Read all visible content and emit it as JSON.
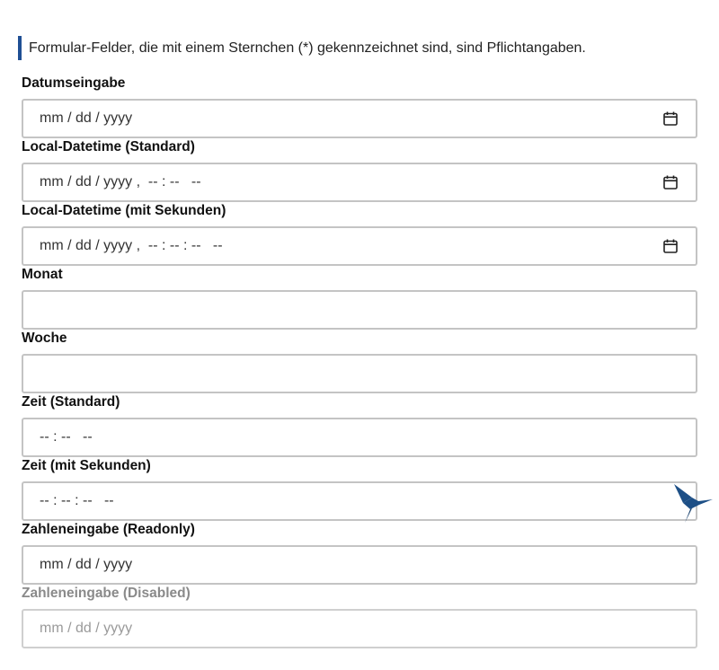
{
  "notice": "Formular-Felder, die mit einem Sternchen (*) gekennzeichnet sind, sind Pflichtangaben.",
  "fields": [
    {
      "label": "Datumseingabe",
      "value": "mm / dd / yyyy",
      "icon": "calendar-icon"
    },
    {
      "label": "Local-Datetime (Standard)",
      "value": "mm / dd / yyyy ,  -- : --   --",
      "icon": "calendar-icon"
    },
    {
      "label": "Local-Datetime (mit Sekunden)",
      "value": "mm / dd / yyyy ,  -- : -- : --   --",
      "icon": "calendar-icon"
    },
    {
      "label": "Monat",
      "value": ""
    },
    {
      "label": "Woche",
      "value": ""
    },
    {
      "label": "Zeit (Standard)",
      "value": "-- : --   --"
    },
    {
      "label": "Zeit (mit Sekunden)",
      "value": "-- : -- : --   --"
    },
    {
      "label": "Zahleneingabe (Readonly)",
      "value": "mm / dd / yyyy"
    },
    {
      "label": "Zahleneingabe (Disabled)",
      "value": "mm / dd / yyyy"
    }
  ],
  "colors": {
    "accent": "#1f4f94",
    "border": "#c4c4c4",
    "disabled_text": "#8a8a8a",
    "logo": "#1d4f86"
  },
  "logo_icon": "hummingbird-logo-icon"
}
